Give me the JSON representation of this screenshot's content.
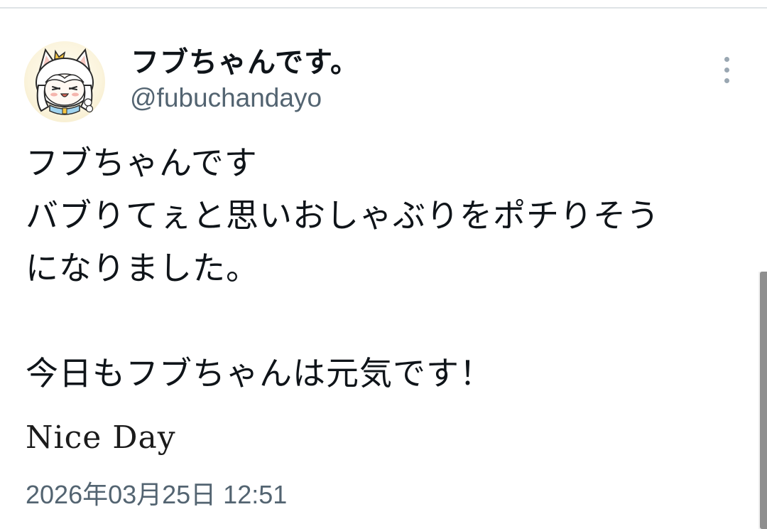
{
  "tweet": {
    "author": {
      "display_name": "フブちゃんです。",
      "handle": "@fubuchandayo",
      "avatar_icon": "avatar-character-icon"
    },
    "more_icon": "more-options-icon",
    "text_lines": [
      "フブちゃんです",
      "バブりてぇと思いおしゃぶりをポチりそう",
      "になりました。",
      "",
      "今日もフブちゃんは元気です！"
    ],
    "signature": "Nice Day",
    "timestamp": "2026年03月25日 12:51"
  },
  "colors": {
    "text_primary": "#0f1419",
    "text_secondary": "#536471",
    "divider": "#dfe3e6",
    "scrollbar": "#8f8f8f"
  }
}
